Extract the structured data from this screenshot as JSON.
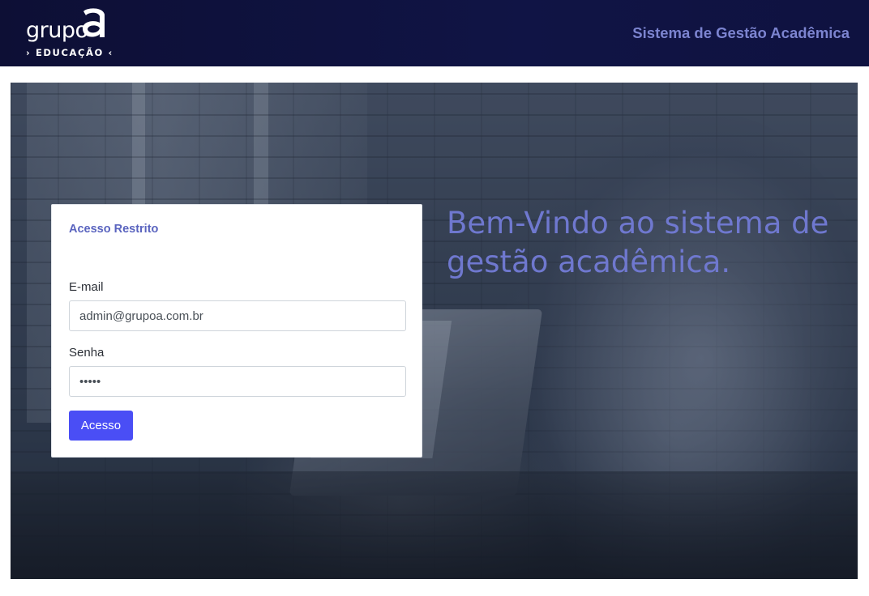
{
  "header": {
    "logo_word": "grupo",
    "logo_sub": "› EDUCAÇÃO ‹",
    "title": "Sistema de Gestão Acadêmica"
  },
  "login": {
    "title": "Acesso Restrito",
    "email_label": "E-mail",
    "email_value": "admin@grupoa.com.br",
    "password_label": "Senha",
    "password_value": "12345",
    "submit_label": "Acesso"
  },
  "hero": {
    "welcome": "Bem-Vindo ao sistema de gestão acadêmica."
  },
  "colors": {
    "header_bg": "#0f1240",
    "accent": "#6f78cf",
    "button": "#4a4ef5"
  }
}
